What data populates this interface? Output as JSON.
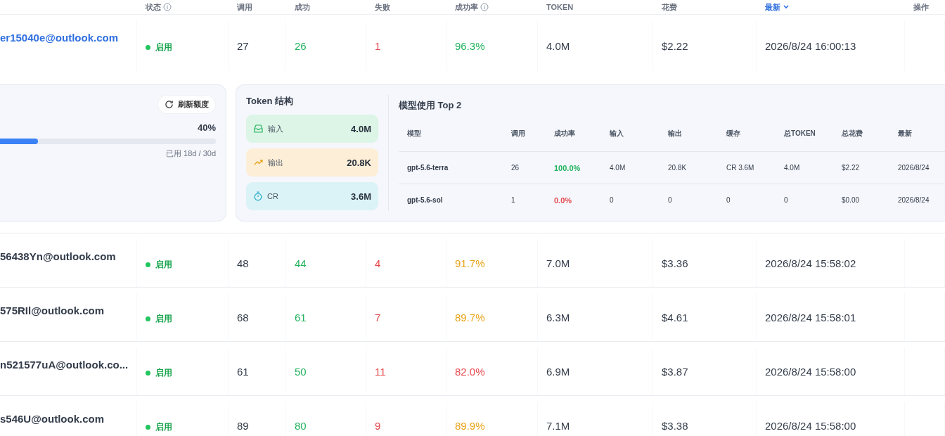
{
  "table": {
    "columns": [
      {
        "label": "状态",
        "info": true,
        "sorted": false
      },
      {
        "label": "调用",
        "info": false,
        "sorted": false
      },
      {
        "label": "成功",
        "info": false,
        "sorted": false
      },
      {
        "label": "失败",
        "info": false,
        "sorted": false
      },
      {
        "label": "成功率",
        "info": true,
        "sorted": false
      },
      {
        "label": "TOKEN",
        "info": false,
        "sorted": false
      },
      {
        "label": "花费",
        "info": false,
        "sorted": false
      },
      {
        "label": "最新",
        "info": false,
        "sorted": true
      },
      {
        "label": "操作",
        "info": false,
        "sorted": false
      }
    ],
    "rows": [
      {
        "account": "er15040e@outlook.com",
        "expanded": true,
        "status": "启用",
        "enabled": true,
        "calls": "27",
        "success": "26",
        "fail": "1",
        "rate": "96.3%",
        "color": "#22b35e",
        "tokens": "4.0M",
        "cost": "$2.22",
        "latest": "2026/8/24 16:00:13"
      },
      {
        "account": "56438Yn@outlook.com",
        "expanded": false,
        "status": "启用",
        "enabled": true,
        "calls": "48",
        "success": "44",
        "fail": "4",
        "rate": "91.7%",
        "color": "#e8a317",
        "tokens": "7.0M",
        "cost": "$3.36",
        "latest": "2026/8/24 15:58:02"
      },
      {
        "account": "575RIl@outlook.com",
        "expanded": false,
        "status": "启用",
        "enabled": true,
        "calls": "68",
        "success": "61",
        "fail": "7",
        "rate": "89.7%",
        "color": "#e8a317",
        "tokens": "6.3M",
        "cost": "$4.61",
        "latest": "2026/8/24 15:58:01"
      },
      {
        "account": "n521577uA@outlook.co...",
        "expanded": false,
        "status": "启用",
        "enabled": true,
        "calls": "61",
        "success": "50",
        "fail": "11",
        "rate": "82.0%",
        "color": "#e5484d",
        "tokens": "6.9M",
        "cost": "$3.87",
        "latest": "2026/8/24 15:58:00"
      },
      {
        "account": "s546U@outlook.com",
        "expanded": false,
        "status": "启用",
        "enabled": true,
        "calls": "89",
        "success": "80",
        "fail": "9",
        "rate": "89.9%",
        "color": "#e8a317",
        "tokens": "7.1M",
        "cost": "$3.38",
        "latest": "2026/8/24 15:58:00"
      }
    ]
  },
  "detail": {
    "quota": {
      "refresh_button": "刷新额度",
      "percent": "40%",
      "level": 0.4,
      "usage": "已用 18d / 30d"
    },
    "token_structure": {
      "title": "Token 结构",
      "items": [
        {
          "kind": "input",
          "label": "输入",
          "value": "4.0M"
        },
        {
          "kind": "output",
          "label": "输出",
          "value": "20.8K"
        },
        {
          "kind": "cache",
          "label": "CR",
          "value": "3.6M"
        }
      ]
    },
    "models": {
      "title": "模型使用 Top 2",
      "columns": [
        "模型",
        "调用",
        "成功率",
        "输入",
        "输出",
        "缓存",
        "总TOKEN",
        "总花费",
        "最新"
      ],
      "rows": [
        {
          "model": "gpt-5.6-terra",
          "calls": "26",
          "rate": "100.0%",
          "color": "#22b35e",
          "input": "4.0M",
          "output": "20.8K",
          "cache": "CR 3.6M",
          "total_tokens": "4.0M",
          "total_cost": "$2.22",
          "latest": "2026/8/24"
        },
        {
          "model": "gpt-5.6-sol",
          "calls": "1",
          "rate": "0.0%",
          "color": "#e5484d",
          "input": "0",
          "output": "0",
          "cache": "0",
          "total_tokens": "0",
          "total_cost": "$0.00",
          "latest": "2026/8/24"
        }
      ]
    }
  }
}
